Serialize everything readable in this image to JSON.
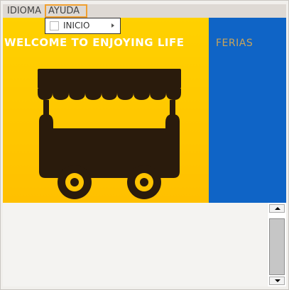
{
  "menubar": {
    "items": [
      {
        "label": "IDIOMA"
      },
      {
        "label": "AYUDA"
      }
    ],
    "dropdown": {
      "items": [
        {
          "label": "INICIO"
        }
      ]
    }
  },
  "banner": {
    "welcome_text": "WELCOME TO ENJOYING LIFE",
    "side_text": "FERIAS",
    "icon": "food-truck-icon",
    "colors": {
      "yellow": "#ffc800",
      "blue": "#0f64c6",
      "icon": "#2a1b0c",
      "side_text": "#c8a45a"
    }
  },
  "scrollbar": {
    "up_icon": "arrow-up-icon",
    "down_icon": "arrow-down-icon"
  }
}
